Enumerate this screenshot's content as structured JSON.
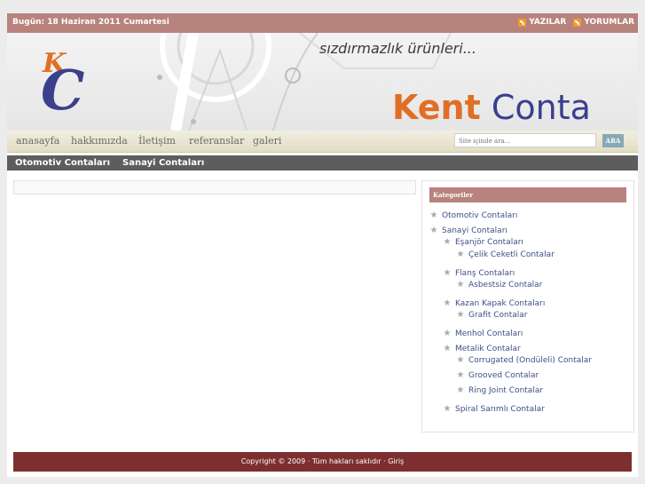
{
  "topbar": {
    "date": "Bugün: 18 Haziran 2011 Cumartesi",
    "links": [
      "YAZILAR",
      "YORUMLAR"
    ]
  },
  "header": {
    "slogan": "sızdırmazlık ürünleri...",
    "brand_part1": "Kent",
    "brand_part2": " Conta",
    "logo_text": "KC"
  },
  "nav": {
    "items": [
      "anasayfa",
      "hakkımızda",
      "İletişim",
      "referanslar",
      "galeri"
    ],
    "search_placeholder": "Site içinde ara...",
    "search_button": "ARA"
  },
  "catbar": {
    "items": [
      "Otomotiv Contaları",
      "Sanayi Contaları"
    ]
  },
  "sidebar": {
    "title": "Kategoriler",
    "categories": [
      "Otomotiv Contaları",
      "Sanayi Contaları",
      "Eşanjör Contaları",
      "Çelik Ceketli Contalar",
      "Flanş Contaları",
      "Asbestsiz Contalar",
      "Kazan Kapak Contaları",
      "Grafit Contalar",
      "Menhol Contaları",
      "Metalik Contalar",
      "Corrugated (Ondüleli) Contalar",
      "Grooved Contalar",
      "Ring Joint Contalar",
      "Spiral Sarımlı Contalar"
    ]
  },
  "footer": {
    "text": "Copyright © 2009 · Tüm hakları saklıdır · Giriş"
  },
  "colors": {
    "topbar": "#b8827d",
    "footer": "#7d2f2f",
    "brand_orange": "#e06f26",
    "brand_blue": "#3a3f8e",
    "link": "#3f4f86"
  }
}
